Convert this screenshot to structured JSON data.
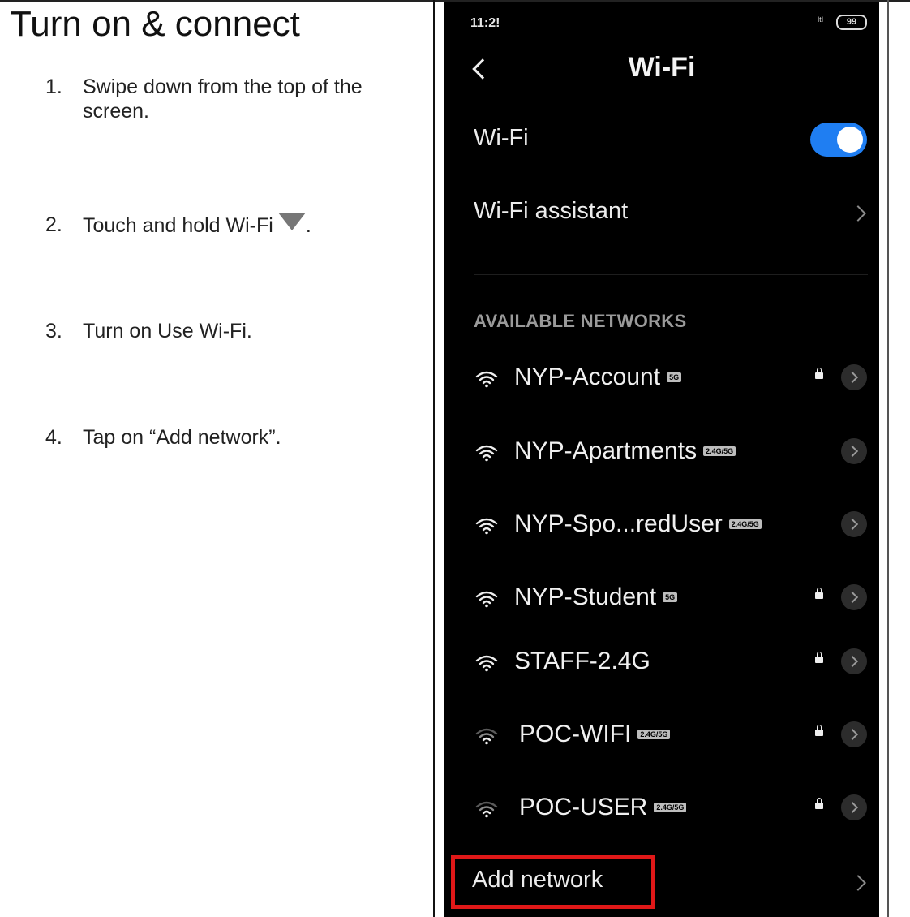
{
  "document": {
    "title": "Turn on & connect",
    "steps": [
      {
        "number": "1.",
        "text": "Swipe down from the top of the screen."
      },
      {
        "number": "2.",
        "text": "Touch and hold Wi-Fi",
        "suffix": ".",
        "icon": "wifi-triangle-icon"
      },
      {
        "number": "3.",
        "text": "Turn on Use Wi-Fi."
      },
      {
        "number": "4.",
        "text": "Tap on “Add network”."
      }
    ]
  },
  "phone": {
    "status_bar": {
      "time": "11:2!",
      "signal": "ᴵᵗˡ",
      "battery": "99"
    },
    "header": {
      "title": "Wi-Fi"
    },
    "wifi_toggle": {
      "label": "Wi-Fi",
      "on": true,
      "color": "#1f7ef2"
    },
    "assistant": {
      "label": "Wi-Fi assistant"
    },
    "section_title": "AVAILABLE NETWORKS",
    "networks": [
      {
        "name": "NYP-Account",
        "band": "5G",
        "locked": true
      },
      {
        "name": "NYP-Apartments",
        "band": "2.4G/5G",
        "locked": false
      },
      {
        "name": "NYP-Spo...redUser",
        "band": "2.4G/5G",
        "locked": false
      },
      {
        "name": "NYP-Student",
        "band": "5G",
        "locked": true
      },
      {
        "name": "STAFF-2.4G",
        "band": "",
        "locked": true
      },
      {
        "name": "POC-WIFI",
        "band": "2.4G/5G",
        "locked": true
      },
      {
        "name": "POC-USER",
        "band": "2.4G/5G",
        "locked": true
      }
    ],
    "add_network": {
      "label": "Add network",
      "highlight_color": "#e01818"
    }
  }
}
